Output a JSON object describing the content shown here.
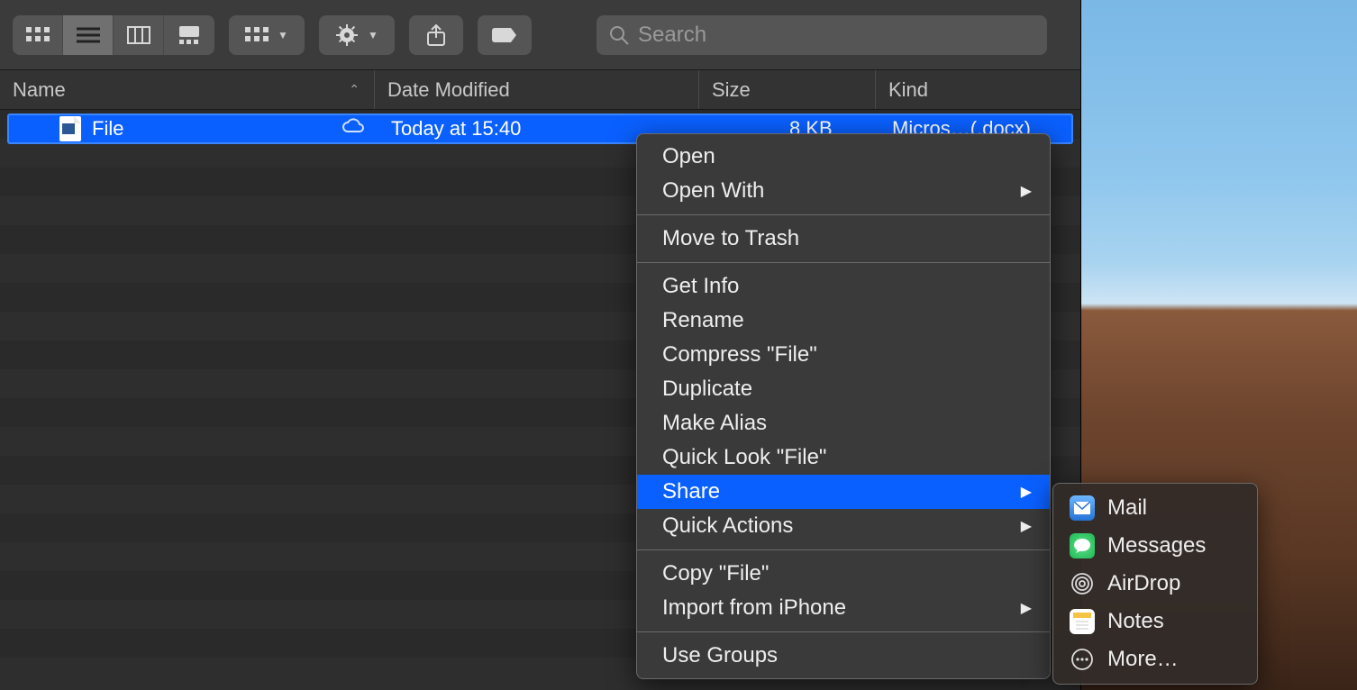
{
  "toolbar": {
    "search_placeholder": "Search"
  },
  "columns": {
    "name": "Name",
    "date": "Date Modified",
    "size": "Size",
    "kind": "Kind"
  },
  "file": {
    "name": "File",
    "date": "Today at 15:40",
    "size": "8 KB",
    "kind": "Micros…(.docx)"
  },
  "context_menu": {
    "open": "Open",
    "open_with": "Open With",
    "move_to_trash": "Move to Trash",
    "get_info": "Get Info",
    "rename": "Rename",
    "compress": "Compress \"File\"",
    "duplicate": "Duplicate",
    "make_alias": "Make Alias",
    "quick_look": "Quick Look \"File\"",
    "share": "Share",
    "quick_actions": "Quick Actions",
    "copy": "Copy \"File\"",
    "import_iphone": "Import from iPhone",
    "use_groups": "Use Groups"
  },
  "share_menu": {
    "mail": "Mail",
    "messages": "Messages",
    "airdrop": "AirDrop",
    "notes": "Notes",
    "more": "More…"
  }
}
